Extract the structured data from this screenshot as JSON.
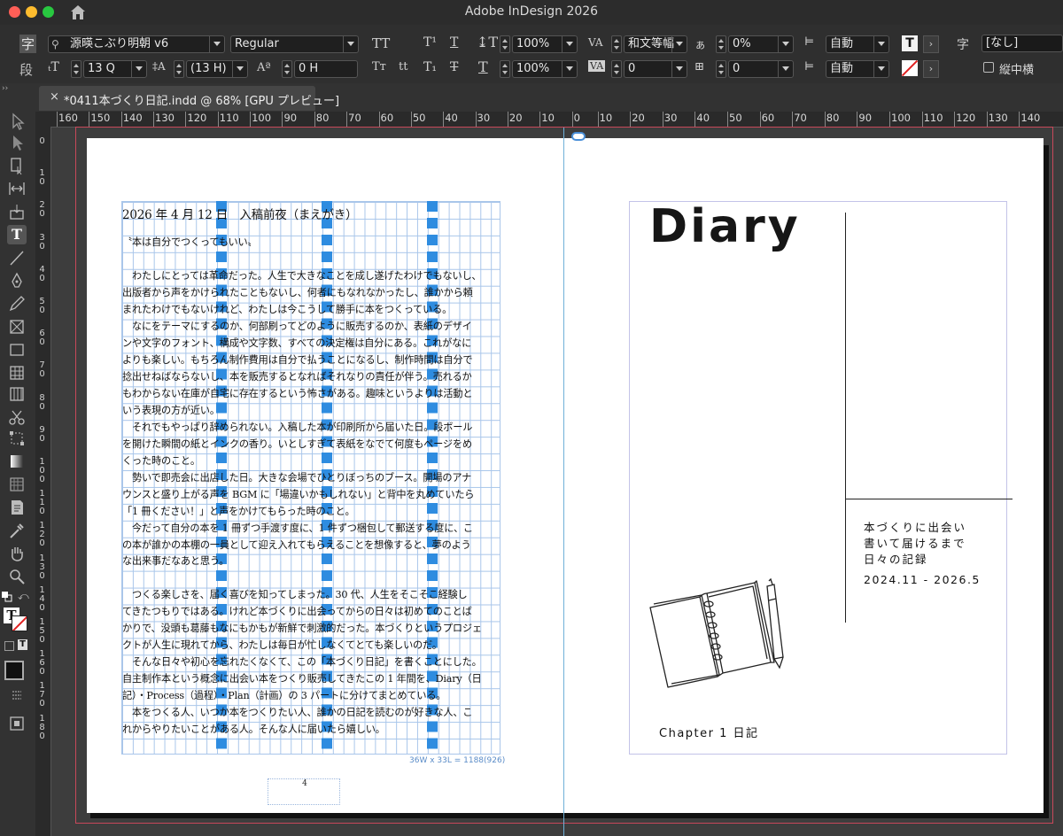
{
  "window": {
    "title": "Adobe InDesign 2026"
  },
  "control_panel": {
    "char_mode_icon": "字",
    "para_mode_icon": "段",
    "font_family": "源暎こぶり明朝 v6",
    "font_style": "Regular",
    "font_size": "13 Q",
    "leading": "(13 H)",
    "kerning_shift": "0 H",
    "vertical_scale": "100%",
    "horizontal_scale": "100%",
    "kerning": "和文等幅",
    "tracking": "0",
    "tsume": "0%",
    "baseline": "0",
    "aki_before": "自動",
    "aki_after": "自動",
    "char_style_icon": "字",
    "char_style": "[なし]",
    "tatechuyoko": "縦中横"
  },
  "document_tab": {
    "close": "×",
    "label": "*0411本づくり日記.indd @ 68% [GPU プレビュー]"
  },
  "ruler": {
    "horizontal": [
      "160",
      "150",
      "140",
      "130",
      "120",
      "110",
      "100",
      "90",
      "80",
      "70",
      "60",
      "50",
      "40",
      "30",
      "20",
      "10",
      "0",
      "10",
      "20",
      "30",
      "40",
      "50",
      "60",
      "70",
      "80",
      "90",
      "100",
      "110",
      "120",
      "130",
      "140"
    ],
    "vertical": [
      "0",
      "1\n0",
      "2\n0",
      "3\n0",
      "4\n0",
      "5\n0",
      "6\n0",
      "7\n0",
      "8\n0",
      "9\n0",
      "1\n0\n0",
      "1\n1\n0",
      "1\n2\n0",
      "1\n3\n0",
      "1\n4\n0",
      "1\n5\n0",
      "1\n6\n0",
      "1\n7\n0",
      "1\n8\n0"
    ]
  },
  "left_page": {
    "lines": [
      "2026 年 4 月 12 日　入稿前夜（まえがき）",
      "",
      "〝本は自分でつくってもいい〟",
      "",
      "　わたしにとっては革命だった。人生で大きなことを成し遂げたわけでもないし、",
      "出版者から声をかけられたこともないし、何者にもなれなかったし、誰かから頼",
      "まれたわけでもないけれど、わたしは今こうして勝手に本をつくっている。",
      "　なにをテーマにするのか、何部刷ってどのように販売するのか、表紙のデザイ",
      "ンや文字のフォント、構成や文字数、すべての決定権は自分にある。これがなに",
      "よりも楽しい。もちろん制作費用は自分で払うことになるし、制作時間は自分で",
      "捻出せねばならないし、本を販売するとなればそれなりの責任が伴う。売れるか",
      "もわからない在庫が自宅に存在するという怖さがある。趣味というよりは活動と",
      "いう表現の方が近い。",
      "　それでもやっぱり辞められない。入稿した本が印刷所から届いた日。段ボール",
      "を開けた瞬間の紙とインクの香り。いとしすぎて表紙をなでて何度もページをめ",
      "くった時のこと。",
      "　勢いで即売会に出店した日。大きな会場でひとりぼっちのブース。開場のアナ",
      "ウンスと盛り上がる声を BGM に「場違いかもしれない」と背中を丸めていたら",
      "「1 冊ください！」と声をかけてもらった時のこと。",
      "　今だって自分の本を 1 冊ずつ手渡す度に、1 件ずつ梱包して郵送する度に、こ",
      "の本が誰かの本棚の一員として迎え入れてもらえることを想像すると、夢のよう",
      "な出来事だなあと思う。",
      "",
      "　つくる楽しさを、届く喜びを知ってしまった。30 代、人生をそこそこ経験し",
      "てきたつもりではある。けれど本づくりに出会ってからの日々は初めてのことば",
      "かりで、没頭も葛藤もなにもかもが新鮮で刺激的だった。本づくりというプロジェ",
      "クトが人生に現れてから、わたしは毎日が忙しなくてとても楽しいのだ。",
      "　そんな日々や初心を忘れたくなくて、この「本づくり日記」を書くことにした。",
      "自主制作本という概念に出会い本をつくり販売してきたこの 1 年間を、Diary（日",
      "記）・Process（過程）・Plan（計画）の 3 パートに分けてまとめている。",
      "　本をつくる人、いつか本をつくりたい人、誰かの日記を読むのが好きな人、こ",
      "れからやりたいことがある人。そんな人に届いたら嬉しい。"
    ],
    "frame_info": "36W x 33L = 1188(926)",
    "folio": "4"
  },
  "right_page": {
    "title": "Diary",
    "subtitle_lines": [
      "本づくりに出会い",
      "書いて届けるまで",
      "日々の記録"
    ],
    "period": "2024.11 - 2026.5",
    "chapter": "Chapter 1  日記"
  },
  "colors": {
    "grid": "#a9c6ea",
    "highlight": "#2e8ce0",
    "bleed": "#c8485a"
  }
}
